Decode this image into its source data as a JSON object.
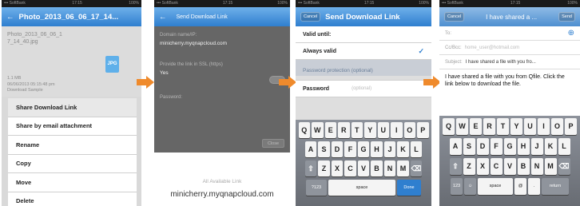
{
  "step1": {
    "title": "Photo_2013_06_06_17_14...",
    "file_name": "Photo_2013_06_06_1 7_14_40.jpg",
    "file_size": "1.1 MB",
    "file_date": "06/06/2013 05:15:48 pm",
    "file_location": "Download Sample",
    "doc_icon_label": "JPG",
    "menu": [
      "Share Download Link",
      "Share by email attachment",
      "Rename",
      "Copy",
      "Move",
      "Delete"
    ]
  },
  "step2": {
    "nav_title": "Send Download Link",
    "field1_label": "Domain name/IP:",
    "field1_value": "minicherry.myqnapcloud.com",
    "field2_label": "Provide the link in SSL (https)",
    "field2_value": "Yes",
    "field3_label": "Password:",
    "button_label": "Close",
    "caption": "All Available Link",
    "url": "minicherry.myqnapcloud.com"
  },
  "step3": {
    "cancel_label": "Cancel",
    "title": "Send Download Link",
    "options": [
      "Valid until:",
      "Always valid"
    ],
    "checkmark": "✓",
    "section_header": "Password protection (optional)",
    "password_label": "Password",
    "password_placeholder": "(optional)",
    "keys_row1": [
      "Q",
      "W",
      "E",
      "R",
      "T",
      "Y",
      "U",
      "I",
      "O",
      "P"
    ],
    "keys_row2": [
      "A",
      "S",
      "D",
      "F",
      "G",
      "H",
      "J",
      "K",
      "L"
    ],
    "keys_row3": [
      "⇧",
      "Z",
      "X",
      "C",
      "V",
      "B",
      "N",
      "M",
      "⌫"
    ],
    "keys_bottom": [
      "?123",
      "space",
      "Done"
    ]
  },
  "step4": {
    "cancel_label": "Cancel",
    "title": "I have shared a ...",
    "send_label": "Send",
    "to_label": "To:",
    "cc_label": "Cc/Bcc:",
    "cc_value": "home_user@hotmail.com",
    "subject_label": "Subject:",
    "subject_value": "I have shared a file with you fro...",
    "body": "I have shared a file with you from Qfile. Click the link below to download the file.",
    "keys_row1": [
      "Q",
      "W",
      "E",
      "R",
      "T",
      "Y",
      "U",
      "I",
      "O",
      "P"
    ],
    "keys_row2": [
      "A",
      "S",
      "D",
      "F",
      "G",
      "H",
      "J",
      "K",
      "L"
    ],
    "keys_row3": [
      "⇧",
      "Z",
      "X",
      "C",
      "V",
      "B",
      "N",
      "M",
      "⌫"
    ],
    "keys_bottom": [
      "123",
      "☺",
      "space",
      "@",
      ".",
      "return"
    ]
  },
  "status": {
    "carrier": "••• SoftBank",
    "time": "17:15",
    "battery": "100%"
  },
  "colors": {
    "accent_blue": "#2f7fcf",
    "arrow_orange": "#ef8a2c"
  }
}
